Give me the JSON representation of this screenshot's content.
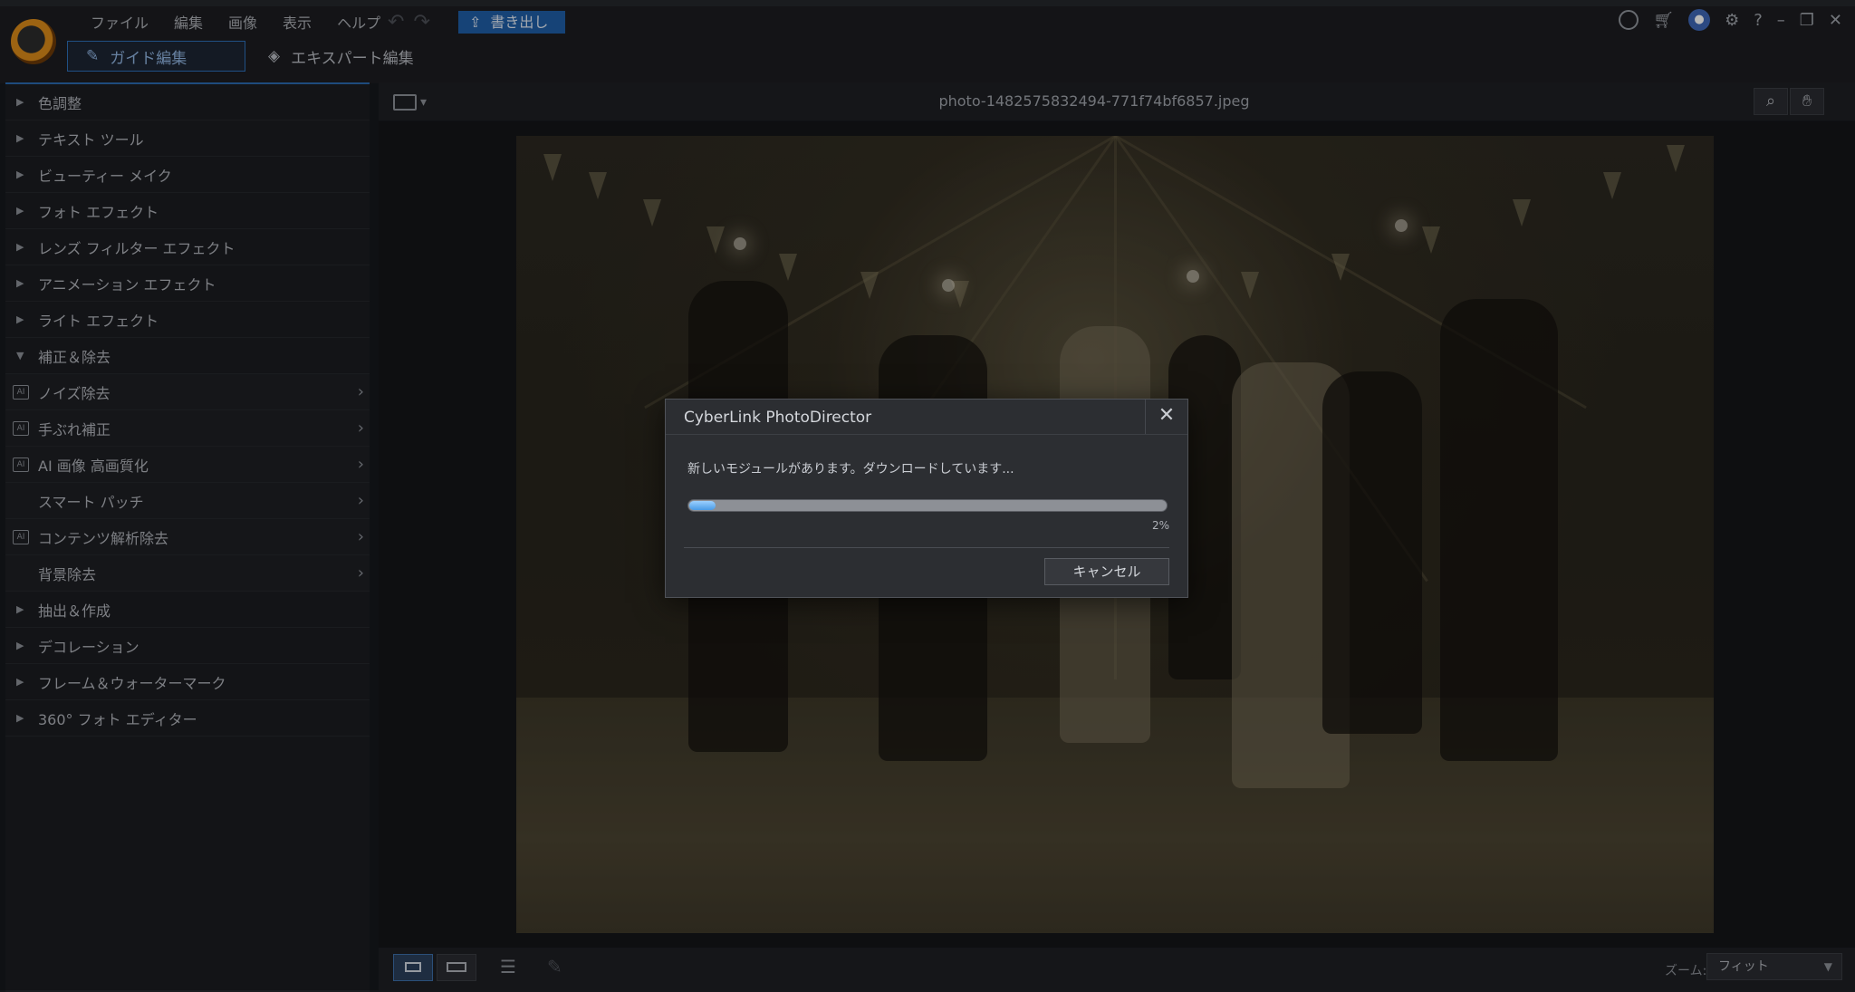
{
  "menu": {
    "items": [
      "ファイル",
      "編集",
      "画像",
      "表示",
      "ヘルプ"
    ],
    "undo_icon": "undo-icon",
    "redo_icon": "redo-icon",
    "export_label": "書き出し"
  },
  "modes": {
    "guided_label": "ガイド編集",
    "expert_label": "エキスパート編集"
  },
  "sidebar": {
    "items": [
      {
        "label": "色調整",
        "state": "collapsed"
      },
      {
        "label": "テキスト ツール",
        "state": "collapsed"
      },
      {
        "label": "ビューティー メイク",
        "state": "collapsed"
      },
      {
        "label": "フォト エフェクト",
        "state": "collapsed"
      },
      {
        "label": "レンズ フィルター エフェクト",
        "state": "collapsed"
      },
      {
        "label": "アニメーション エフェクト",
        "state": "collapsed"
      },
      {
        "label": "ライト エフェクト",
        "state": "collapsed"
      },
      {
        "label": "補正＆除去",
        "state": "expanded"
      },
      {
        "label": "ノイズ除去",
        "sub": true,
        "ai": true
      },
      {
        "label": "手ぶれ補正",
        "sub": true,
        "ai": true
      },
      {
        "label": "AI 画像 高画質化",
        "sub": true,
        "ai": true
      },
      {
        "label": "スマート パッチ",
        "sub": true,
        "ai": false
      },
      {
        "label": "コンテンツ解析除去",
        "sub": true,
        "ai": true
      },
      {
        "label": "背景除去",
        "sub": true,
        "ai": false
      },
      {
        "label": "抽出＆作成",
        "state": "collapsed"
      },
      {
        "label": "デコレーション",
        "state": "collapsed"
      },
      {
        "label": "フレーム＆ウォーターマーク",
        "state": "collapsed"
      },
      {
        "label": "360° フォト エディター",
        "state": "collapsed"
      }
    ]
  },
  "main": {
    "filename": "photo-1482575832494-771f74bf6857.jpeg"
  },
  "bottom": {
    "zoom_label": "ズーム:",
    "zoom_value": "フィット"
  },
  "dialog": {
    "title": "CyberLink PhotoDirector",
    "close_glyph": "✕",
    "message": "新しいモジュールがあります。ダウンロードしています...",
    "progress_fraction": 0.02,
    "progress_text": "2%",
    "cancel_label": "キャンセル"
  },
  "colors": {
    "accent": "#1f5ea6",
    "progress": "#4a9be6"
  }
}
